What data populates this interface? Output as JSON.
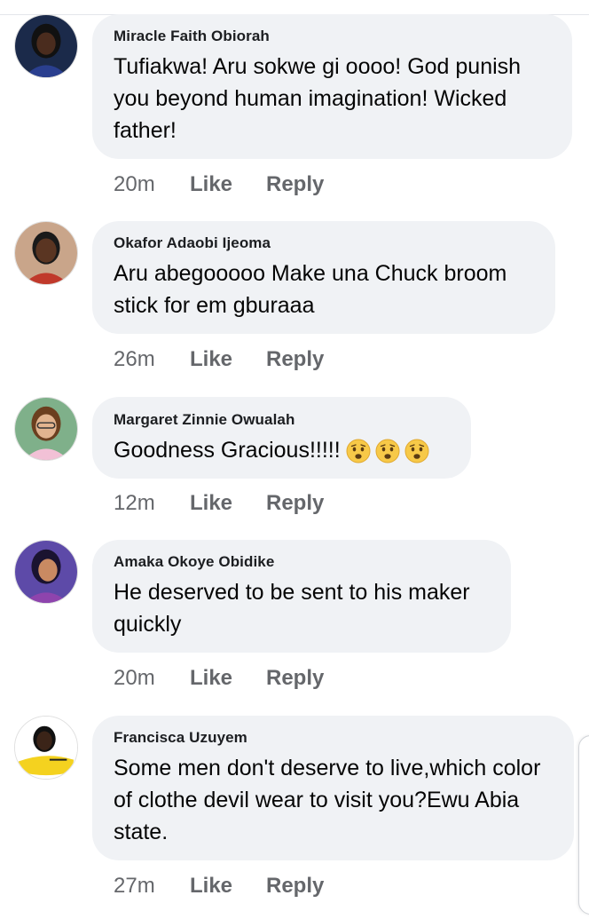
{
  "comments": [
    {
      "author": "Miracle Faith Obiorah",
      "text": "Tufiakwa! Aru sokwe gi oooo! God punish you beyond human imagination! Wicked father!",
      "time": "20m",
      "like": "Like",
      "reply": "Reply",
      "avatar_colors": {
        "bg": "#1b2a4a",
        "skin": "#4a2c1e",
        "hair": "#111111",
        "cloth": "#2a3f8f"
      }
    },
    {
      "author": "Okafor Adaobi Ijeoma",
      "text": "Aru abegooooo Make una Chuck broom stick for em gburaaa",
      "time": "26m",
      "like": "Like",
      "reply": "Reply",
      "avatar_colors": {
        "bg": "#c9a58a",
        "skin": "#5a3522",
        "hair": "#1a1a1a",
        "cloth": "#c0392b"
      }
    },
    {
      "author": "Margaret Zinnie Owualah",
      "text": "Goodness Gracious!!!!!",
      "emojis": [
        "worried-face-icon",
        "worried-face-icon",
        "worried-face-icon"
      ],
      "time": "12m",
      "like": "Like",
      "reply": "Reply",
      "avatar_colors": {
        "bg": "#7fb08a",
        "skin": "#e2b48f",
        "hair": "#6b3f1f",
        "cloth": "#f2c1d6"
      }
    },
    {
      "author": "Amaka Okoye Obidike",
      "text": "He deserved to be sent to his maker quickly",
      "time": "20m",
      "like": "Like",
      "reply": "Reply",
      "avatar_colors": {
        "bg": "#5d4aa8",
        "skin": "#c98a62",
        "hair": "#1a1330",
        "cloth": "#8e44ad"
      }
    },
    {
      "author": "Francisca Uzuyem",
      "text": "Some men don't deserve to live,which color of clothe devil wear to visit you?Ewu Abia state.",
      "time": "27m",
      "like": "Like",
      "reply": "Reply",
      "avatar_colors": {
        "bg": "#ffffff",
        "skin": "#3b2418",
        "hair": "#111111",
        "cloth": "#f4d21f"
      }
    }
  ]
}
